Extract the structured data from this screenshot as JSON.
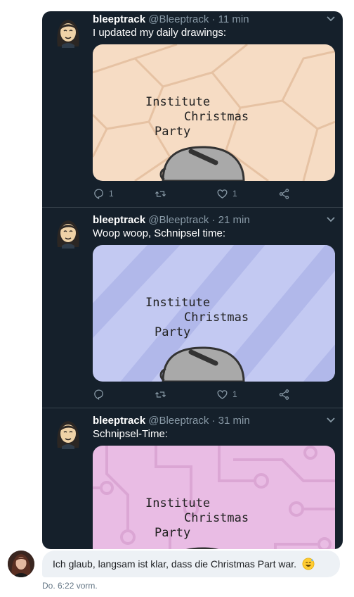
{
  "colors": {
    "embed_bg": "#15202b",
    "muted": "#8899a6",
    "divider": "#38444d",
    "bubble_bg": "#edf1f5",
    "media1_bg": "#f6dcc4",
    "media2_bg": "#c3c9f2",
    "media3_bg": "#e9bce4"
  },
  "tweets": [
    {
      "name": "bleeptrack",
      "handle": "@Bleeptrack",
      "separator": "·",
      "time": "11 min",
      "text": "I updated my daily drawings:",
      "media_lines": [
        "Institute",
        "Christmas",
        "Party"
      ],
      "replies": "1",
      "retweets": "",
      "likes": "1"
    },
    {
      "name": "bleeptrack",
      "handle": "@Bleeptrack",
      "separator": "·",
      "time": "21 min",
      "text": "Woop woop, Schnipsel time:",
      "media_lines": [
        "Institute",
        "Christmas",
        "Party"
      ],
      "replies": "",
      "retweets": "",
      "likes": "1"
    },
    {
      "name": "bleeptrack",
      "handle": "@Bleeptrack",
      "separator": "·",
      "time": "31 min",
      "text": "Schnipsel-Time:",
      "media_lines": [
        "Institute",
        "Christmas",
        "Party"
      ]
    }
  ],
  "message": {
    "text": "Ich glaub, langsam ist klar, dass die Christmas Part war.",
    "emoji": "sweat-smile-emoji",
    "timestamp": "Do. 6:22 vorm."
  }
}
